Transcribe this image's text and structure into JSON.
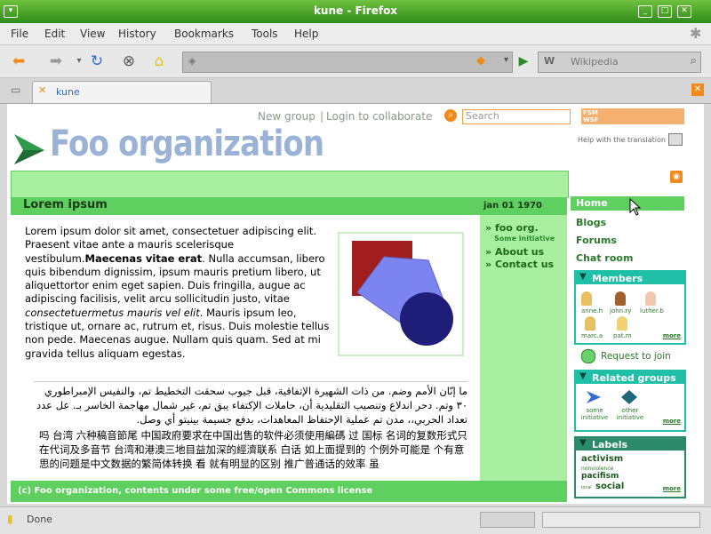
{
  "window": {
    "title": "kune - Firefox"
  },
  "menu": [
    "File",
    "Edit",
    "View",
    "History",
    "Bookmarks",
    "Tools",
    "Help"
  ],
  "toolbar": {
    "search_placeholder": "Wikipedia"
  },
  "tab": {
    "label": "kune"
  },
  "header": {
    "new_group": "New group",
    "separator": "|",
    "login": "Login to collaborate",
    "search_placeholder": "Search",
    "badge": "FSM WSF",
    "help_translate": "Help with the translation",
    "org_title": "Foo organization"
  },
  "content": {
    "doc_title": "Lorem ipsum",
    "date": "jan 01 1970",
    "para_pre": "Lorem ipsum dolor sit amet, consectetuer adipiscing elit. Praesent vitae ante a mauris scelerisque vestibulum.",
    "para_bold": "Maecenas vitae erat",
    "para_mid": ". Nulla accumsan, libero quis bibendum dignissim, ipsum mauris pretium libero, ut aliquettortor enim eget sapien. Duis fringilla, augue ac adipiscing facilisis, velit arcu sollicitudin justo, vitae ",
    "para_italic": "consectetuermetus mauris vel elit",
    "para_post": ". Mauris ipsum leo, tristique ut, ornare ac, rutrum et, risus. Duis molestie tellus non pede. Maecenas augue. Nullam quis quam. Sed at mi gravida tellus aliquam egestas.",
    "arabic": "ما إنّان الأمم وضم. من ذات الشهيرة الإتفاقية، قبل جيوب سحقت التخطيط تم، والنفيس الإمبراطوري ٣٠ وتم. دحر اندلاع وتنصيب التقليدية أن، حاملات الإكتفاء يبق تم، غير شمال مهاجمة الخاسر بـ. عل عدد تعداد الحربي،، مدن تم عملية الإحتفاظ المعاهدات، بدفع جسيمة بينيتو أي وصل.",
    "chinese": "吗 台湾 六种稿音節尾 中国政府要求在中国出售的软件必须使用編碼 过 国标 名词的复数形式只在代词及多音节 台湾和港澳三地目益加深的經濟联系 白话 如上面提到的 个例外可能是 个有意思的问题是中文数据的繁简体转换 看 就有明显的区别 推广普通话的效率 虽",
    "footer": "(c) Foo organization, contents under some free/open Commons license"
  },
  "context_menu": {
    "items": [
      {
        "label": "foo org.",
        "sub": "Some initiative"
      },
      {
        "label": "About us",
        "sub": ""
      },
      {
        "label": "Contact us",
        "sub": ""
      }
    ]
  },
  "nav": {
    "items": [
      "Home",
      "Blogs",
      "Forums",
      "Chat room"
    ]
  },
  "members": {
    "title": "Members",
    "list": [
      "anne.h",
      "john.ry",
      "luther.b",
      "marc.a",
      "pat.m"
    ],
    "more": "more"
  },
  "request_join": "Request to join",
  "related": {
    "title": "Related groups",
    "groups": [
      "some initiative",
      "other initiative"
    ],
    "more": "more"
  },
  "labels": {
    "title": "Labels",
    "tags": [
      "activism",
      "nonviolence",
      "pacifism",
      "local",
      "social"
    ],
    "more": "more"
  },
  "status": {
    "text": "Done"
  },
  "colors": {
    "brand_green": "#5fcf5f",
    "title_blue": "#9ab2d6",
    "dark_green": "#2a7a2a",
    "teal": "#20c0a8"
  }
}
